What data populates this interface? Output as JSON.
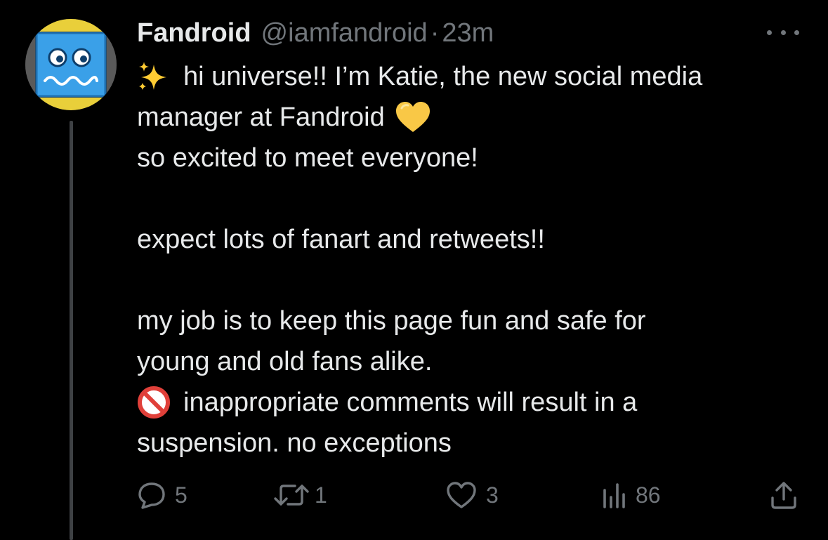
{
  "tweet": {
    "author": {
      "display_name": "Fandroid",
      "handle": "@iamfandroid",
      "separator": "·",
      "time": "23m"
    },
    "body": {
      "line1": "hi universe!! I’m Katie, the new social media",
      "line2": "manager at Fandroid",
      "line3": "so excited to meet everyone!",
      "line4": "expect lots of fanart and retweets!!",
      "line5": "my job is to keep this page fun and safe for",
      "line6": "young and old fans alike.",
      "line7": "inappropriate comments will result in a",
      "line8": "suspension. no exceptions"
    },
    "emojis": {
      "line1_prefix": "sparkles-icon",
      "line2_suffix": "yellow-heart-icon",
      "line7_prefix": "no-entry-sign-icon"
    },
    "actions": {
      "replies": "5",
      "reposts": "1",
      "likes": "3",
      "views": "86"
    }
  },
  "colors": {
    "background": "#000000",
    "text_primary": "#e7e9ea",
    "text_secondary": "#71767b",
    "thread_line": "#3e4144",
    "heart_yellow": "#f9c846",
    "sparkle_yellow": "#ffcc33",
    "no_entry_red": "#e0403a",
    "avatar_blue": "#3aa0e8",
    "avatar_ring_yellow": "#e9cf3a"
  }
}
